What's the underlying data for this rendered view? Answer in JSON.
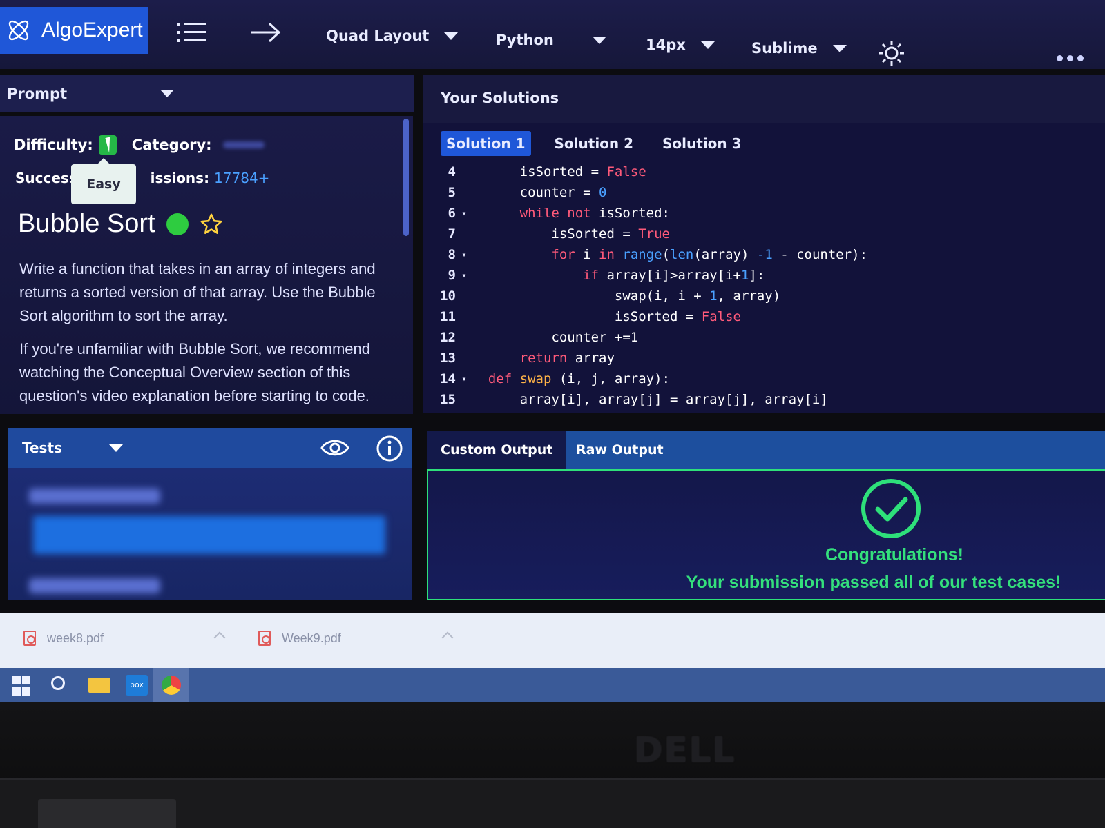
{
  "app": {
    "logo_text": "AlgoExpert"
  },
  "toolbar": {
    "layout": "Quad Layout",
    "language": "Python",
    "font_size": "14px",
    "theme": "Sublime"
  },
  "prompt": {
    "header": "Prompt",
    "difficulty_label": "Difficulty:",
    "category_label": "Category:",
    "success_label": "Success",
    "submissions_label": "issions:",
    "submissions_value": "17784+",
    "tooltip": "Easy",
    "title": "Bubble Sort",
    "desc_p1": "Write a function that takes in an array of integers and returns a sorted version of that array. Use the Bubble Sort algorithm to sort the array.",
    "desc_p2": "If you're unfamiliar with Bubble Sort, we recommend watching the Conceptual Overview section of this question's video explanation before starting to code."
  },
  "solutions": {
    "header": "Your Solutions",
    "tabs": [
      "Solution 1",
      "Solution 2",
      "Solution 3"
    ],
    "active_tab": "Solution 1"
  },
  "code_lines": [
    {
      "num": "4",
      "fold": false,
      "indent": "    ",
      "tokens": [
        [
          "isSorted = ",
          ""
        ],
        [
          "False",
          "bool"
        ]
      ]
    },
    {
      "num": "5",
      "fold": false,
      "indent": "    ",
      "tokens": [
        [
          "counter = ",
          ""
        ],
        [
          "0",
          "num"
        ]
      ]
    },
    {
      "num": "6",
      "fold": true,
      "indent": "    ",
      "tokens": [
        [
          "while not ",
          "kw"
        ],
        [
          "isSorted:",
          ""
        ]
      ]
    },
    {
      "num": "7",
      "fold": false,
      "indent": "        ",
      "tokens": [
        [
          "isSorted = ",
          ""
        ],
        [
          "True",
          "bool"
        ]
      ]
    },
    {
      "num": "8",
      "fold": true,
      "indent": "        ",
      "tokens": [
        [
          "for ",
          "kw"
        ],
        [
          "i ",
          ""
        ],
        [
          "in ",
          "kw"
        ],
        [
          "range",
          "bi"
        ],
        [
          "(",
          ""
        ],
        [
          "len",
          "bi"
        ],
        [
          "(array) ",
          ""
        ],
        [
          "-1",
          "num"
        ],
        [
          " - counter):",
          ""
        ]
      ]
    },
    {
      "num": "9",
      "fold": true,
      "indent": "            ",
      "tokens": [
        [
          "if ",
          "kw"
        ],
        [
          "array[i]>array[i+",
          ""
        ],
        [
          "1",
          "num"
        ],
        [
          "]:",
          ""
        ]
      ]
    },
    {
      "num": "10",
      "fold": false,
      "indent": "                ",
      "tokens": [
        [
          "swap(i, i + ",
          ""
        ],
        [
          "1",
          "num"
        ],
        [
          ", array)",
          ""
        ]
      ]
    },
    {
      "num": "11",
      "fold": false,
      "indent": "                ",
      "tokens": [
        [
          "isSorted = ",
          ""
        ],
        [
          "False",
          "bool"
        ]
      ]
    },
    {
      "num": "12",
      "fold": false,
      "indent": "        ",
      "tokens": [
        [
          "counter +=1",
          ""
        ]
      ]
    },
    {
      "num": "13",
      "fold": false,
      "indent": "    ",
      "tokens": [
        [
          "return ",
          "kw"
        ],
        [
          "array",
          ""
        ]
      ]
    },
    {
      "num": "14",
      "fold": true,
      "indent": "",
      "tokens": [
        [
          "def ",
          "kw"
        ],
        [
          "swap ",
          "fn"
        ],
        [
          "(i, j, array):",
          ""
        ]
      ]
    },
    {
      "num": "15",
      "fold": false,
      "indent": "    ",
      "tokens": [
        [
          "array[i], array[j] = array[j], array[i]",
          ""
        ]
      ]
    }
  ],
  "tests": {
    "header": "Tests"
  },
  "output": {
    "tabs": [
      "Custom Output",
      "Raw Output"
    ],
    "active_tab": "Custom Output",
    "congrats": "Congratulations!",
    "message": "Your submission passed all of our test cases!"
  },
  "downloads": [
    {
      "name": "week8.pdf"
    },
    {
      "name": "Week9.pdf"
    }
  ],
  "bezel": {
    "brand": "DELL"
  },
  "colors": {
    "accent": "#1f57d8",
    "success": "#34e07c",
    "keyword": "#ff5a7a",
    "number": "#4aa0ff"
  }
}
